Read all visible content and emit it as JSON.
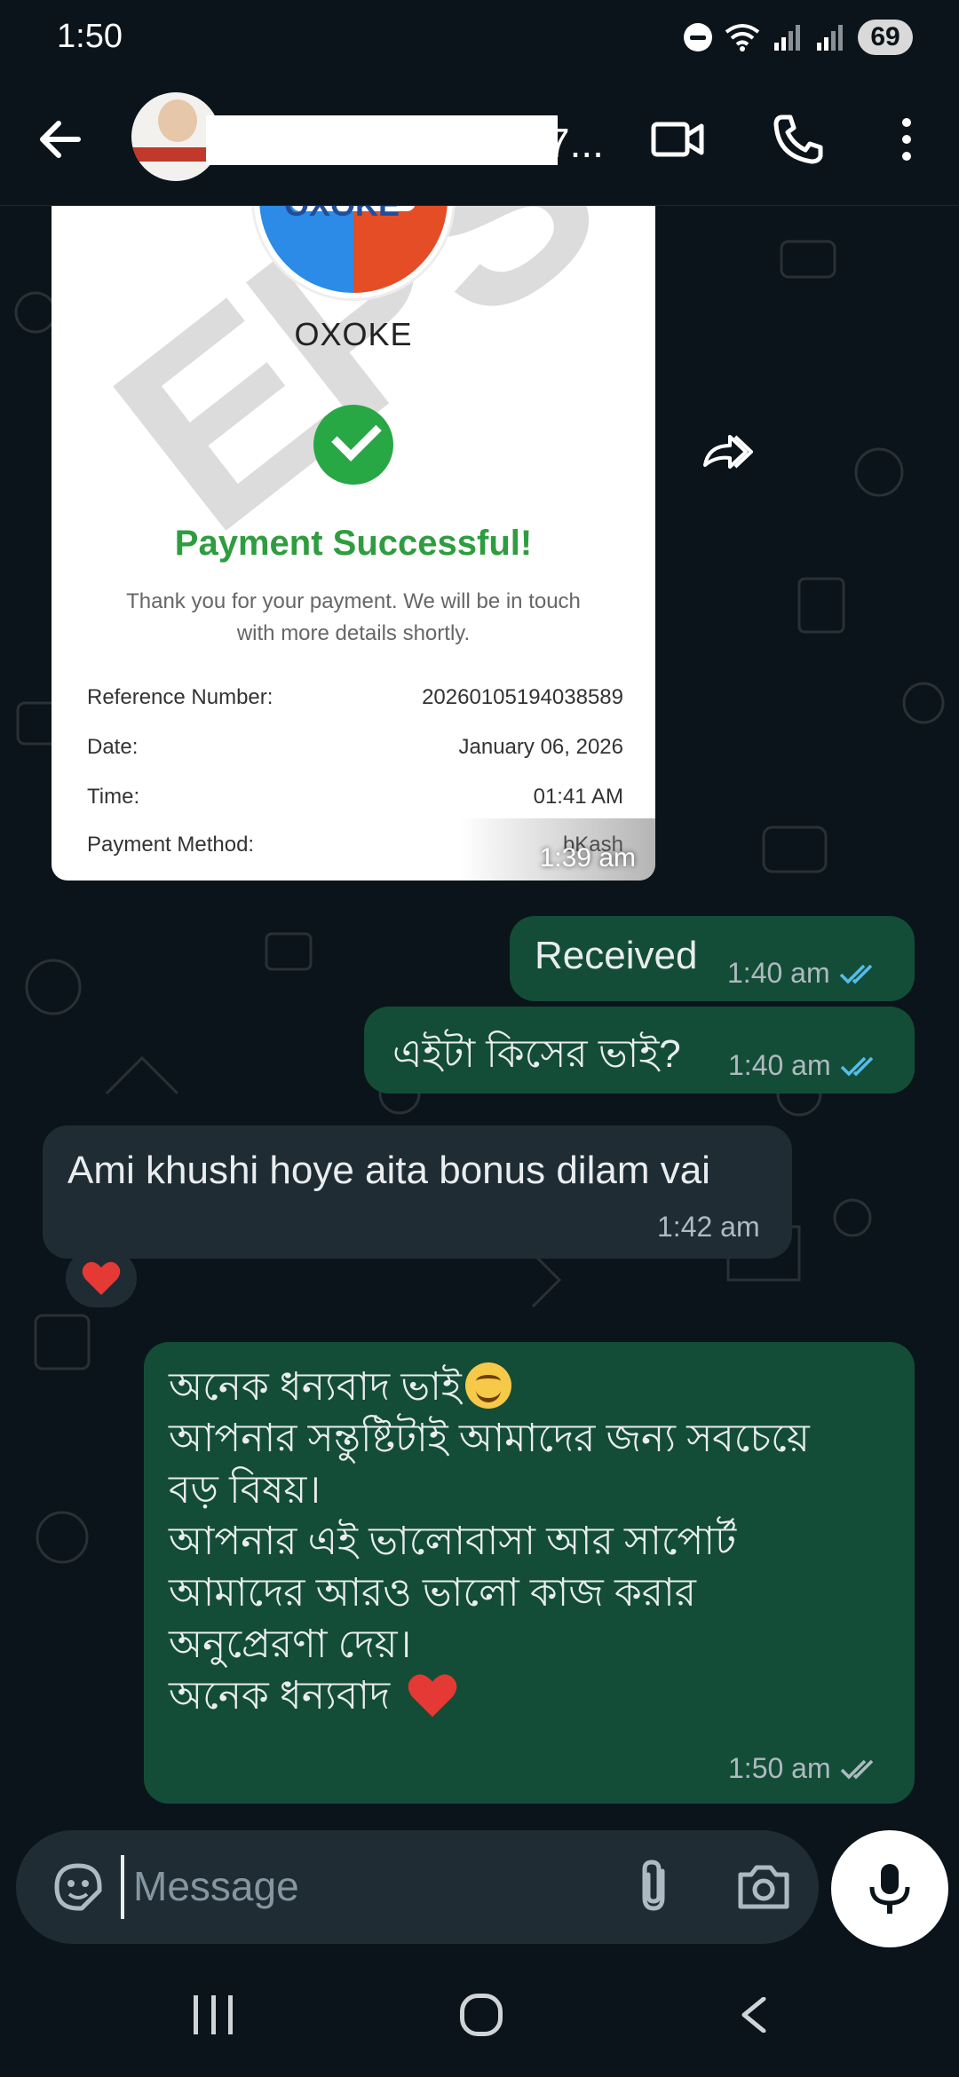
{
  "status_bar": {
    "time": "1:50",
    "battery": "69"
  },
  "header": {
    "contact_name_suffix": "7..."
  },
  "receipt": {
    "logo_text": "OXOKE",
    "brand": "OXOKE",
    "watermark": "EPS",
    "title": "Payment Successful!",
    "message": "Thank you for your payment. We will be in touch with more details shortly.",
    "rows": [
      {
        "label": "Reference Number:",
        "value": "20260105194038589"
      },
      {
        "label": "Date:",
        "value": "January 06, 2026"
      },
      {
        "label": "Time:",
        "value": "01:41 AM"
      },
      {
        "label": "Payment Method:",
        "value": "bKash"
      }
    ],
    "timestamp": "1:39 am"
  },
  "messages": [
    {
      "text": "Received",
      "time": "1:40 am"
    },
    {
      "text": "এইটা কিসের ভাই?",
      "time": "1:40 am"
    },
    {
      "text": "Ami khushi hoye aita bonus dilam vai",
      "time": "1:42 am"
    },
    {
      "lines": [
        "অনেক ধন্যবাদ ভাই",
        "আপনার সন্তুষ্টিটাই আমাদের জন্য সবচেয়ে",
        "বড় বিষয়।",
        "আপনার এই ভালোবাসা আর সাপোর্ট",
        "আমাদের আরও ভালো কাজ করার",
        "অনুপ্রেরণা দেয়।",
        "অনেক ধন্যবাদ"
      ],
      "time": "1:50 am"
    }
  ],
  "composer": {
    "placeholder": "Message"
  },
  "colors": {
    "bg": "#0b141a",
    "incoming": "#1f2c34",
    "outgoing": "#144d37",
    "read_tick": "#53bdeb"
  },
  "icons": [
    "back-arrow-icon",
    "video-call-icon",
    "phone-icon",
    "more-icon",
    "forward-icon",
    "heart-reaction-icon",
    "sticker-icon",
    "attach-icon",
    "camera-icon",
    "mic-icon"
  ]
}
